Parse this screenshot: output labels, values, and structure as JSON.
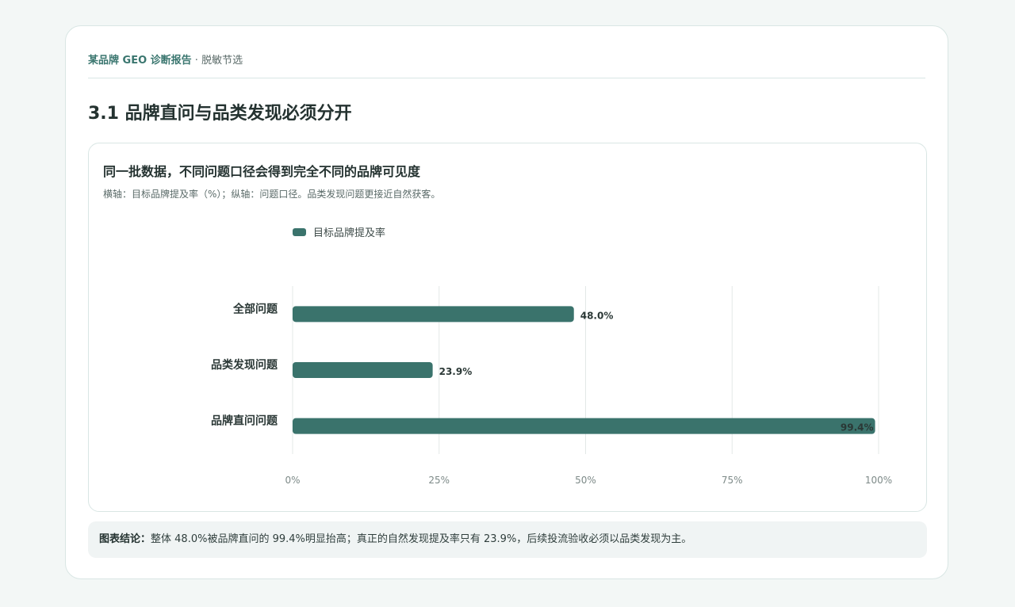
{
  "header": {
    "brand": "某品牌 GEO 诊断报告",
    "separator": "·",
    "tag": "脱敏节选"
  },
  "page_title": "3.1 品牌直问与品类发现必须分开",
  "chart_data": {
    "type": "bar",
    "orientation": "horizontal",
    "title": "同一批数据，不同问题口径会得到完全不同的品牌可见度",
    "subtitle": "横轴：目标品牌提及率（%）；纵轴：问题口径。品类发现问题更接近自然获客。",
    "categories": [
      "全部问题",
      "品类发现问题",
      "品牌直问问题"
    ],
    "series": [
      {
        "name": "目标品牌提及率",
        "values": [
          48.0,
          23.9,
          99.4
        ],
        "color": "#3a736c"
      }
    ],
    "value_labels": [
      "48.0%",
      "23.9%",
      "99.4%"
    ],
    "xlim": [
      0,
      100
    ],
    "x_ticks": [
      0,
      25,
      50,
      75,
      100
    ],
    "x_tick_labels": [
      "0%",
      "25%",
      "50%",
      "75%",
      "100%"
    ],
    "grid": true,
    "legend_position": "top-left"
  },
  "conclusion": {
    "label": "图表结论：",
    "text": "整体 48.0%被品牌直问的 99.4%明显抬高；真正的自然发现提及率只有 23.9%，后续投流验收必须以品类发现为主。"
  }
}
